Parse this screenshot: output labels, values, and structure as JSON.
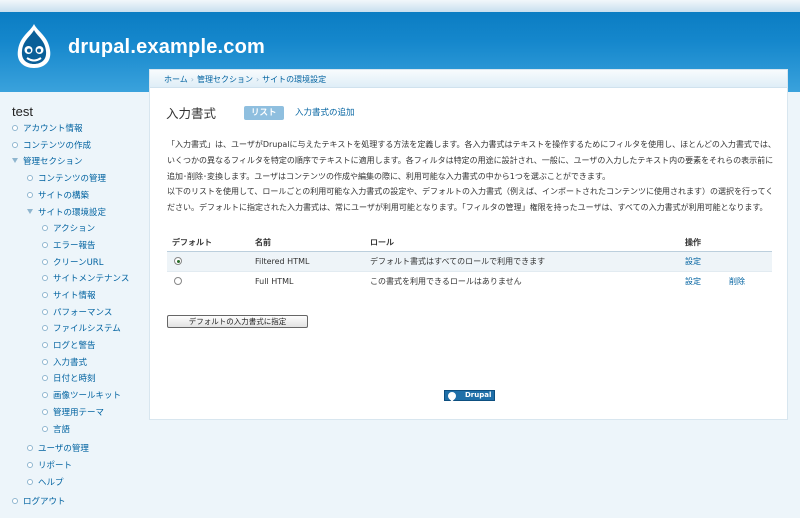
{
  "site": {
    "name": "drupal.example.com"
  },
  "sidebar": {
    "title": "test",
    "items": [
      {
        "label": "アカウント情報",
        "level": 0,
        "open": false
      },
      {
        "label": "コンテンツの作成",
        "level": 0,
        "open": false
      },
      {
        "label": "管理セクション",
        "level": 0,
        "open": true
      },
      {
        "label": "コンテンツの管理",
        "level": 1,
        "open": false
      },
      {
        "label": "サイトの構築",
        "level": 1,
        "open": false
      },
      {
        "label": "サイトの環境設定",
        "level": 1,
        "open": true
      },
      {
        "label": "アクション",
        "level": 2,
        "open": false
      },
      {
        "label": "エラー報告",
        "level": 2,
        "open": false
      },
      {
        "label": "クリーンURL",
        "level": 2,
        "open": false
      },
      {
        "label": "サイトメンテナンス",
        "level": 2,
        "open": false
      },
      {
        "label": "サイト情報",
        "level": 2,
        "open": false
      },
      {
        "label": "パフォーマンス",
        "level": 2,
        "open": false
      },
      {
        "label": "ファイルシステム",
        "level": 2,
        "open": false
      },
      {
        "label": "ログと警告",
        "level": 2,
        "open": false
      },
      {
        "label": "入力書式",
        "level": 2,
        "open": false
      },
      {
        "label": "日付と時刻",
        "level": 2,
        "open": false
      },
      {
        "label": "画像ツールキット",
        "level": 2,
        "open": false
      },
      {
        "label": "管理用テーマ",
        "level": 2,
        "open": false
      },
      {
        "label": "言語",
        "level": 2,
        "open": false
      },
      {
        "label": "ユーザの管理",
        "level": 1,
        "open": false
      },
      {
        "label": "リポート",
        "level": 1,
        "open": false
      },
      {
        "label": "ヘルプ",
        "level": 1,
        "open": false
      },
      {
        "label": "ログアウト",
        "level": 0,
        "open": false
      }
    ]
  },
  "breadcrumb": [
    "ホーム",
    "管理セクション",
    "サイトの環境設定"
  ],
  "breadcrumb_separator": "›",
  "page": {
    "title": "入力書式",
    "tabs": [
      {
        "label": "リスト",
        "active": true
      },
      {
        "label": "入力書式の追加",
        "active": false
      }
    ],
    "description1": "「入力書式」は、ユーザがDrupalに与えたテキストを処理する方法を定義します。各入力書式はテキストを操作するためにフィルタを使用し、ほとんどの入力書式では、いくつかの異なるフィルタを特定の順序でテキストに適用します。各フィルタは特定の用途に設計され、一般に、ユーザの入力したテキスト内の要素をそれらの表示前に追加･削除･変換します。ユーザはコンテンツの作成や編集の際に、利用可能な入力書式の中から1つを選ぶことができます。",
    "description2": "以下のリストを使用して、ロールごとの利用可能な入力書式の設定や、デフォルトの入力書式（例えば、インポートされたコンテンツに使用されます）の選択を行ってください。デフォルトに指定された入力書式は、常にユーザが利用可能となります。「フィルタの管理」権限を持ったユーザは、すべての入力書式が利用可能となります。"
  },
  "table": {
    "headers": {
      "default": "デフォルト",
      "name": "名前",
      "roles": "ロール",
      "operations": "操作"
    },
    "rows": [
      {
        "default": true,
        "name": "Filtered HTML",
        "roles": "デフォルト書式はすべてのロールで利用できます",
        "configure": "設定",
        "delete": ""
      },
      {
        "default": false,
        "name": "Full HTML",
        "roles": "この書式を利用できるロールはありません",
        "configure": "設定",
        "delete": "削除"
      }
    ]
  },
  "buttons": {
    "set_default": "デフォルトの入力書式に指定"
  },
  "footer": {
    "powered_by": "Drupal"
  }
}
